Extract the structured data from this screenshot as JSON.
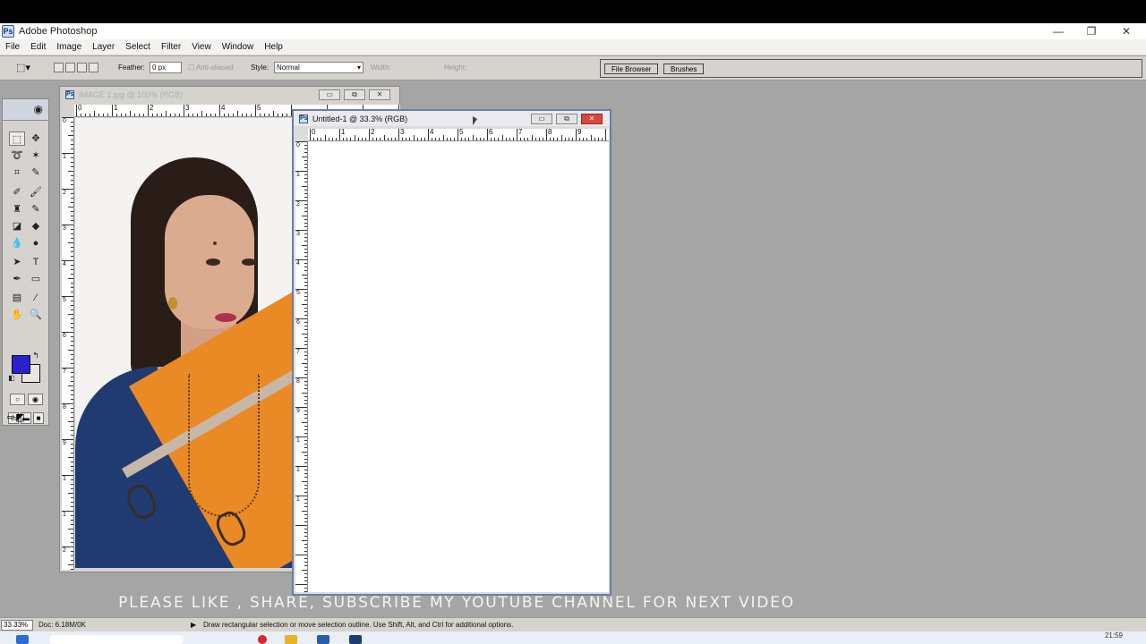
{
  "app": {
    "title": "Adobe Photoshop",
    "icon": "photoshop-icon"
  },
  "window_controls": {
    "minimize": "—",
    "maximize": "❐",
    "close": "✕"
  },
  "menu": [
    "File",
    "Edit",
    "Image",
    "Layer",
    "Select",
    "Filter",
    "View",
    "Window",
    "Help"
  ],
  "options": {
    "feather_label": "Feather:",
    "feather_value": "0 px",
    "anti_aliased": "Anti-aliased",
    "style_label": "Style:",
    "style_value": "Normal",
    "width_label": "Width:",
    "height_label": "Height:"
  },
  "palette_well": {
    "tabs": [
      "File Browser",
      "Brushes"
    ]
  },
  "toolbox": {
    "foreground_color": "#2a20d0",
    "background_color": "#e8e6e2"
  },
  "documents": {
    "image1": {
      "title": "IMAGE 1.jpg @ 100% (RGB)",
      "ruler_h": [
        "0",
        "1",
        "2",
        "3",
        "4",
        "5"
      ],
      "ruler_v": [
        "0",
        "1",
        "2",
        "3",
        "4",
        "5",
        "6",
        "7",
        "8",
        "9",
        "1",
        "1",
        "2"
      ]
    },
    "untitled": {
      "title": "Untitled-1 @ 33.3% (RGB)",
      "ruler_h": [
        "0",
        "1",
        "2",
        "3",
        "4",
        "5",
        "6",
        "7",
        "8",
        "9"
      ],
      "ruler_v": [
        "0",
        "1",
        "2",
        "3",
        "4",
        "5",
        "6",
        "7",
        "8",
        "9",
        "1",
        "1",
        "1"
      ]
    }
  },
  "overlay": {
    "text": "PLEASE LIKE , SHARE, SUBSCRIBE MY YOUTUBE CHANNEL FOR NEXT VIDEO"
  },
  "status": {
    "zoom": "33.33%",
    "doc": "Doc: 6.18M/0K",
    "hint": "Draw rectangular selection or move selection outline.  Use Shift, Alt, and Ctrl for additional options."
  },
  "taskbar": {
    "clock": "21:59"
  }
}
